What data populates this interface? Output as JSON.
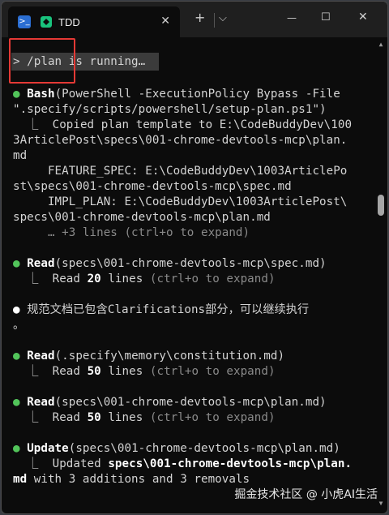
{
  "titlebar": {
    "terminal_icon_label": ">_",
    "tab_title": "TDD",
    "tab_close": "✕",
    "new_tab": "+",
    "dropdown": "⌵",
    "minimize": "—",
    "maximize": "☐",
    "close": "✕"
  },
  "terminal": {
    "prompt": "> /plan is running…",
    "block1": {
      "tool": "Bash",
      "cmd_line1": "(PowerShell -ExecutionPolicy Bypass -File",
      "cmd_line2": "\".specify/scripts/powershell/setup-plan.ps1\")",
      "out1": "  ⎿  Copied plan template to E:\\CodeBuddyDev\\100",
      "out2": "3ArticlePost\\specs\\001-chrome-devtools-mcp\\plan.",
      "out3": "md",
      "out4": "     FEATURE_SPEC: E:\\CodeBuddyDev\\1003ArticlePo",
      "out5": "st\\specs\\001-chrome-devtools-mcp\\spec.md",
      "out6": "     IMPL_PLAN: E:\\CodeBuddyDev\\1003ArticlePost\\",
      "out7": "specs\\001-chrome-devtools-mcp\\plan.md",
      "more": "     … +3 lines (ctrl+o to expand)"
    },
    "block2": {
      "tool": "Read",
      "arg": "(specs\\001-chrome-devtools-mcp\\spec.md)",
      "read_prefix": "  ⎿  Read ",
      "read_count": "20",
      "read_suffix": " lines",
      "hint": " (ctrl+o to expand)"
    },
    "message": {
      "line1": "规范文档已包含Clarifications部分，可以继续执行",
      "line2": "。"
    },
    "block3": {
      "tool": "Read",
      "arg": "(.specify\\memory\\constitution.md)",
      "read_prefix": "  ⎿  Read ",
      "read_count": "50",
      "read_suffix": " lines",
      "hint": " (ctrl+o to expand)"
    },
    "block4": {
      "tool": "Read",
      "arg": "(specs\\001-chrome-devtools-mcp\\plan.md)",
      "read_prefix": "  ⎿  Read ",
      "read_count": "50",
      "read_suffix": " lines",
      "hint": " (ctrl+o to expand)"
    },
    "block5": {
      "tool": "Update",
      "arg": "(specs\\001-chrome-devtools-mcp\\plan.md)",
      "out_prefix": "  ⎿  Updated ",
      "out_path": "specs\\001-chrome-devtools-mcp\\plan.",
      "out2_path": "md",
      "out2_rest": " with 3 additions and 3 removals"
    },
    "bullet_glyph": "●"
  },
  "watermark": "掘金技术社区 @ 小虎AI生活",
  "colors": {
    "background": "#0c0c0c",
    "titlebar": "#1f1f1f",
    "bullet_green": "#52c45a",
    "highlight_red": "#e53935",
    "text": "#d4d4d4",
    "dim": "#8a8a8a"
  }
}
